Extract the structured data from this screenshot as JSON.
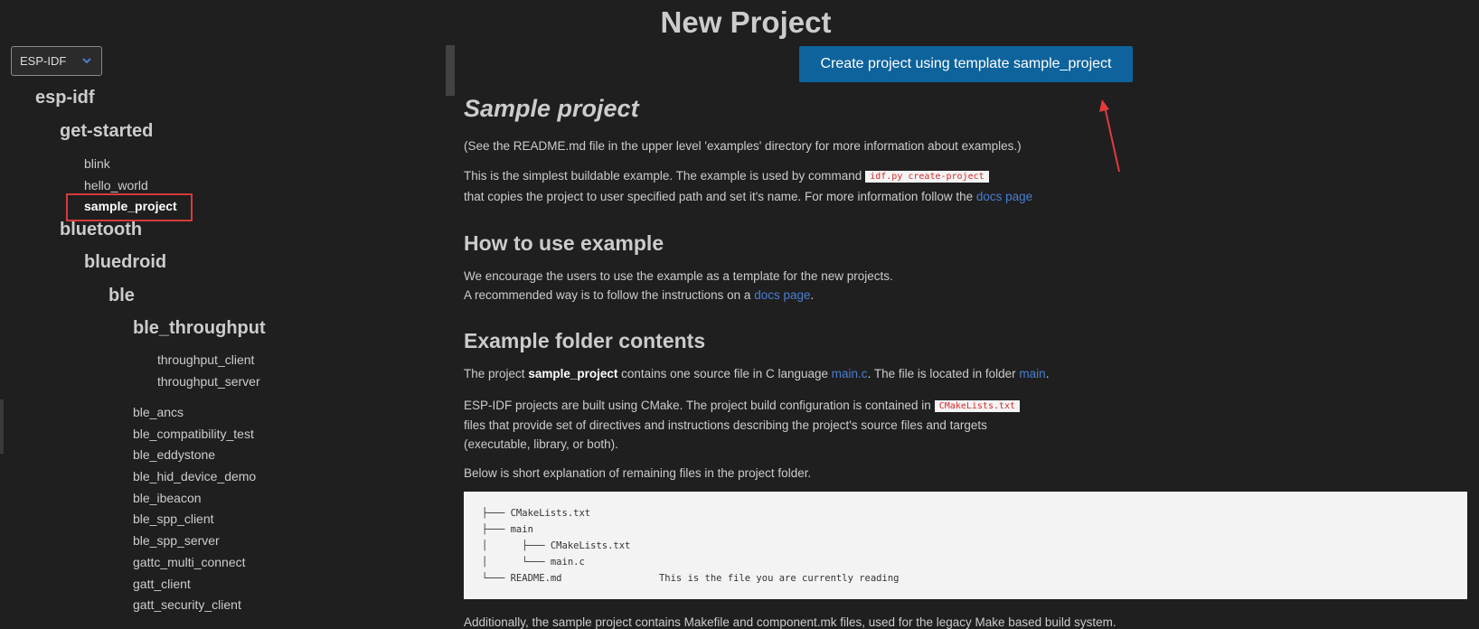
{
  "title": "New Project",
  "framework_dropdown": {
    "selected": "ESP-IDF"
  },
  "tree": {
    "esp_idf": "esp-idf",
    "get_started": "get-started",
    "blink": "blink",
    "hello_world": "hello_world",
    "sample_project": "sample_project",
    "bluetooth": "bluetooth",
    "bluedroid": "bluedroid",
    "ble": "ble",
    "ble_throughput": "ble_throughput",
    "throughput_client": "throughput_client",
    "throughput_server": "throughput_server",
    "ble_items": [
      "ble_ancs",
      "ble_compatibility_test",
      "ble_eddystone",
      "ble_hid_device_demo",
      "ble_ibeacon",
      "ble_spp_client",
      "ble_spp_server",
      "gattc_multi_connect",
      "gatt_client",
      "gatt_security_client"
    ]
  },
  "create_button": "Create project using template sample_project",
  "readme": {
    "title": "Sample project",
    "intro": "(See the README.md file in the upper level 'examples' directory for more information about examples.)",
    "p1a": "This is the simplest buildable example. The example is used by command",
    "p1_code": "idf.py create-project",
    "p1b": "that copies the project to user specified path and set it's name. For more information follow the",
    "docs_link": "docs page",
    "h_how": "How to use example",
    "how1": "We encourage the users to use the example as a template for the new projects.",
    "how2a": "A recommended way is to follow the instructions on a",
    "how2_end": ".",
    "h_folder": "Example folder contents",
    "f1a": "The project",
    "f1_bold": "sample_project",
    "f1b": "contains one source file in C language",
    "f1_link1": "main.c",
    "f1c": ". The file is located in folder",
    "f1_link2": "main",
    "f1_end": ".",
    "f2a": "ESP-IDF projects are built using CMake. The project build configuration is contained in",
    "f2_code": "CMakeLists.txt",
    "f2b": "files that provide set of directives and instructions describing the project's source files and targets",
    "f2c": "(executable, library, or both).",
    "f3": "Below is short explanation of remaining files in the project folder.",
    "tree_block": "├─── CMakeLists.txt\n├─── main\n│      ├─── CMakeLists.txt\n│      └─── main.c\n└─── README.md                 This is the file you are currently reading",
    "f4": "Additionally, the sample project contains Makefile and component.mk files, used for the legacy Make based build system."
  }
}
